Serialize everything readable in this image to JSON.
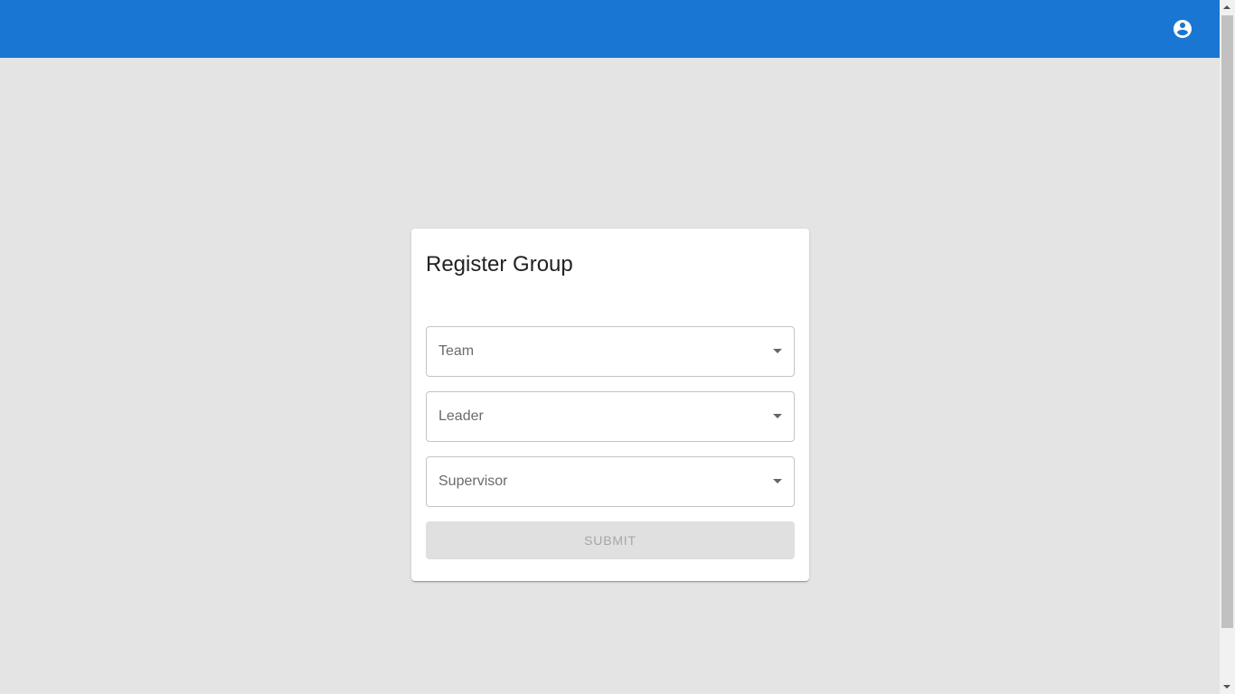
{
  "appbar": {
    "color": "#1976d2",
    "account_icon": "account-circle-icon"
  },
  "form": {
    "title": "Register Group",
    "fields": [
      {
        "label": "Team",
        "icon": "arrow-drop-down-icon"
      },
      {
        "label": "Leader",
        "icon": "arrow-drop-down-icon"
      },
      {
        "label": "Supervisor",
        "icon": "arrow-drop-down-icon"
      }
    ],
    "submit_label": "Submit",
    "submit_disabled": true
  }
}
